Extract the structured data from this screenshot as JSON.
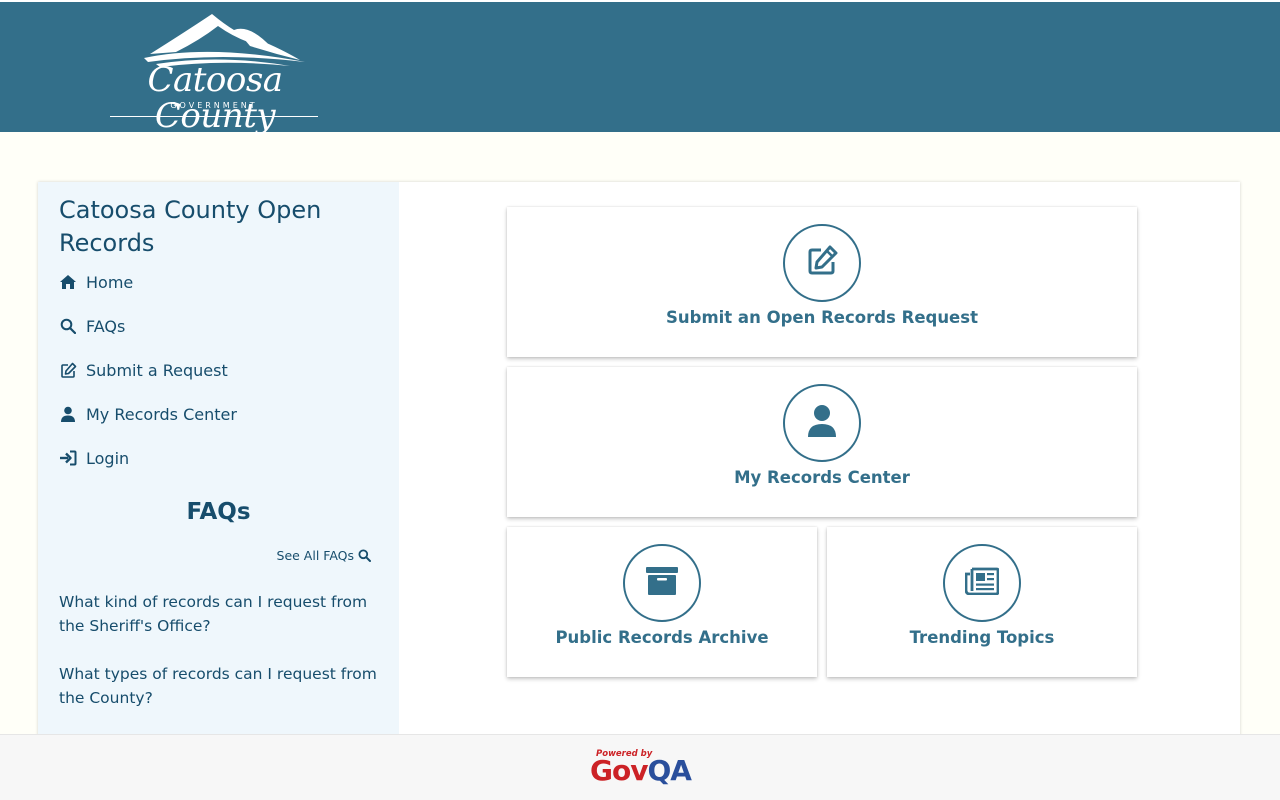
{
  "header": {
    "logo_script": "Catoosa County",
    "logo_sub": "GOVERNMENT",
    "background": "#336f8a"
  },
  "sidebar": {
    "title": "Catoosa County Open Records",
    "nav": [
      {
        "label": "Home",
        "icon": "home-icon"
      },
      {
        "label": "FAQs",
        "icon": "search-icon"
      },
      {
        "label": "Submit a Request",
        "icon": "edit-icon"
      },
      {
        "label": "My Records Center",
        "icon": "user-icon"
      },
      {
        "label": "Login",
        "icon": "sign-in-icon"
      }
    ],
    "faq_heading": "FAQs",
    "see_all": "See All FAQs",
    "faqs": [
      "What kind of records can I request from the Sheriff's Office?",
      "What types of records can I request from the County?"
    ]
  },
  "cards": {
    "submit": {
      "label": "Submit an Open Records Request",
      "icon": "edit-icon"
    },
    "records_center": {
      "label": "My Records Center",
      "icon": "user-icon"
    },
    "archive": {
      "label": "Public Records Archive",
      "icon": "archive-icon"
    },
    "trending": {
      "label": "Trending Topics",
      "icon": "newspaper-icon"
    }
  },
  "footer": {
    "powered_by": "Powered by",
    "brand_gov": "Gov",
    "brand_qa": "QA"
  },
  "colors": {
    "accent": "#336f8a",
    "nav_text": "#174d6c",
    "sidebar_bg": "#eff7fc",
    "brand_red": "#cc2226",
    "brand_blue": "#2a4f9c"
  }
}
